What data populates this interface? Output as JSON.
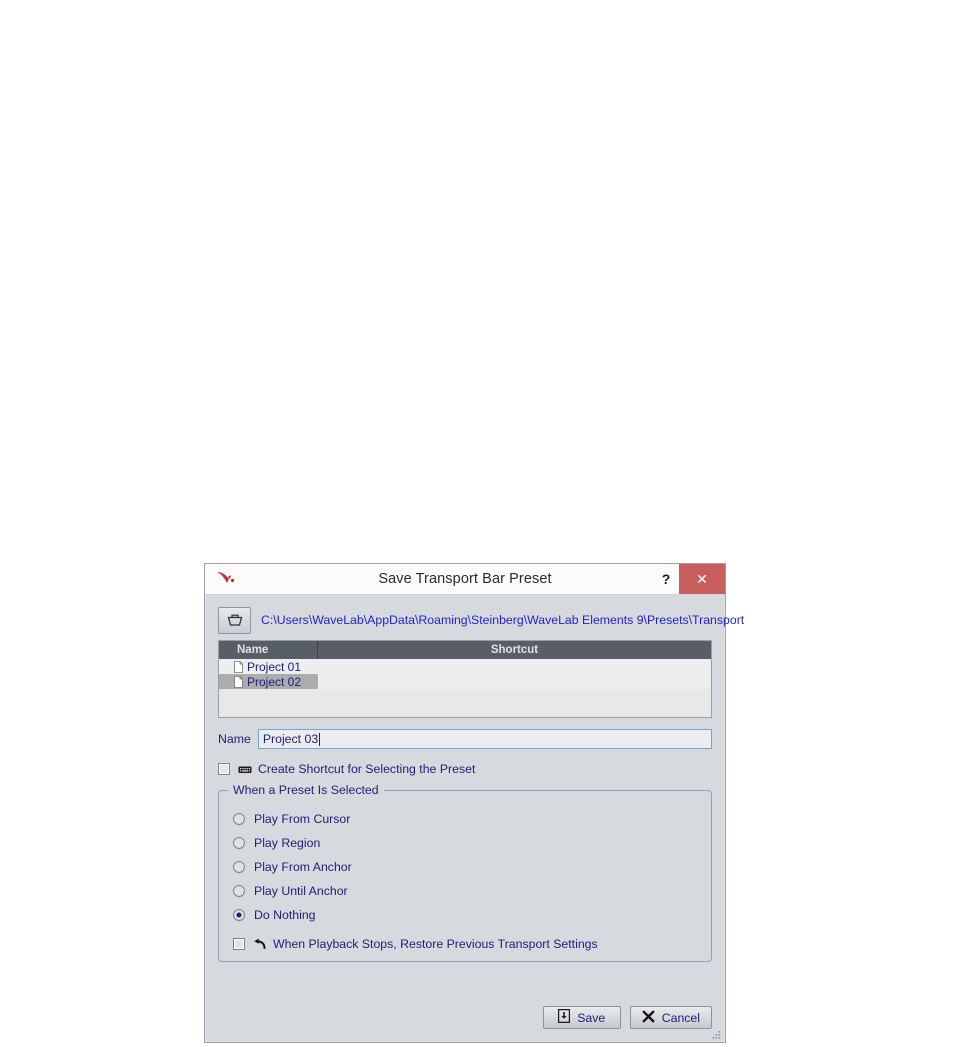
{
  "dialog": {
    "title": "Save Transport Bar Preset",
    "app_icon": "wavelab-logo-icon",
    "help_label": "?",
    "close_label": "✕"
  },
  "path_row": {
    "folder_icon": "folder-icon",
    "path": "C:\\Users\\WaveLab\\AppData\\Roaming\\Steinberg\\WaveLab Elements 9\\Presets\\Transport"
  },
  "preset_list": {
    "columns": [
      "Name",
      "Shortcut"
    ],
    "rows": [
      {
        "name": "Project 01",
        "shortcut": "",
        "selected": false
      },
      {
        "name": "Project 02",
        "shortcut": "",
        "selected": true
      }
    ]
  },
  "name_field": {
    "label": "Name",
    "value": "Project 03",
    "placeholder": ""
  },
  "shortcut_checkbox": {
    "icon": "keyboard-icon",
    "label": "Create Shortcut for Selecting the Preset",
    "checked": false
  },
  "preset_group": {
    "title": "When a Preset Is Selected",
    "options": [
      {
        "label": "Play From Cursor",
        "selected": false
      },
      {
        "label": "Play Region",
        "selected": false
      },
      {
        "label": "Play From Anchor",
        "selected": false
      },
      {
        "label": "Play Until Anchor",
        "selected": false
      },
      {
        "label": "Do Nothing",
        "selected": true
      }
    ],
    "restore_checkbox": {
      "icon": "undo-icon",
      "label": "When Playback Stops, Restore Previous Transport Settings",
      "checked": false
    }
  },
  "footer": {
    "save_label": "Save",
    "save_icon": "save-icon",
    "cancel_label": "Cancel",
    "cancel_icon": "close-x-icon",
    "resize_grip": "resize-grip-icon"
  },
  "colors": {
    "dialog_bg": "#d6dade",
    "titlebar_bg": "#fbfbfb",
    "close_btn": "#c75d5c",
    "header_bg": "#575e66",
    "selection": "#acacac",
    "text_blue": "#20207a",
    "path_blue": "#2222cc",
    "focus_border": "#6fa8d6"
  }
}
